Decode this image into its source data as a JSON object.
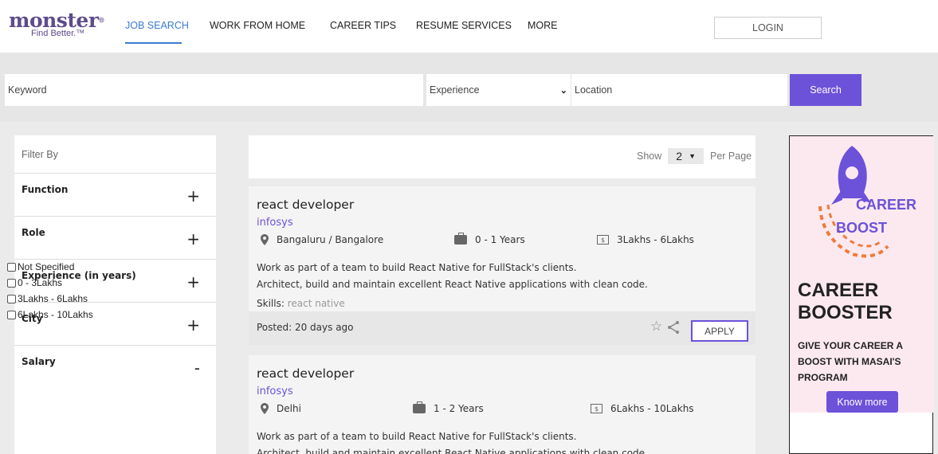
{
  "brand": {
    "name": "monster",
    "tagline": "Find Better.™",
    "reg": "®"
  },
  "nav": {
    "items": [
      "JOB SEARCH",
      "WORK FROM HOME",
      "CAREER TIPS",
      "RESUME SERVICES",
      "MORE"
    ],
    "active": "JOB SEARCH",
    "login_label": "LOGIN"
  },
  "search": {
    "keyword_placeholder": "Keyword",
    "experience_selected": "Experience",
    "location_placeholder": "Location",
    "button_label": "Search"
  },
  "filters": {
    "title": "Filter By",
    "groups": [
      {
        "label": "Function",
        "toggle": "+"
      },
      {
        "label": "Role",
        "toggle": "+"
      },
      {
        "label": "Experience (in years)",
        "toggle": "+"
      },
      {
        "label": "City",
        "toggle": "+"
      },
      {
        "label": "Salary",
        "toggle": "-"
      }
    ],
    "salary_options": [
      "Not Specified",
      "0 - 3Lakhs",
      "3Lakhs - 6Lakhs",
      "6Lakhs - 10Lakhs"
    ]
  },
  "results": {
    "show_label": "Show",
    "per_page_value": "2",
    "per_page_label": "Per Page"
  },
  "jobs": [
    {
      "title": "react developer",
      "company": "infosys",
      "location": "Bangaluru / Bangalore",
      "experience": "0 - 1 Years",
      "salary": "3Lakhs - 6Lakhs",
      "desc1": "Work as part of a team to build React Native for FullStack's clients.",
      "desc2": "Architect, build and maintain excellent React Native applications with clean code.",
      "skills_label": "Skills:",
      "skills": "react native",
      "posted": "Posted: 20 days ago",
      "apply_label": "APPLY"
    },
    {
      "title": "react developer",
      "company": "infosys",
      "location": "Delhi",
      "experience": "1 - 2 Years",
      "salary": "6Lakhs - 10Lakhs",
      "desc1": "Work as part of a team to build React Native for FullStack's clients.",
      "desc2": "Architect, build and maintain excellent React Native applications with clean code."
    }
  ],
  "ad": {
    "career": "CAREER",
    "boost": "BOOST",
    "headline1": "CAREER",
    "headline2": "BOOSTER",
    "subtext": "GIVE YOUR CAREER A BOOST WITH MASAI'S PROGRAM",
    "button_label": "Know more"
  },
  "colors": {
    "brand": "#5e4b8b",
    "accent": "#6c52d9",
    "nav_active": "#3b7bd1"
  }
}
